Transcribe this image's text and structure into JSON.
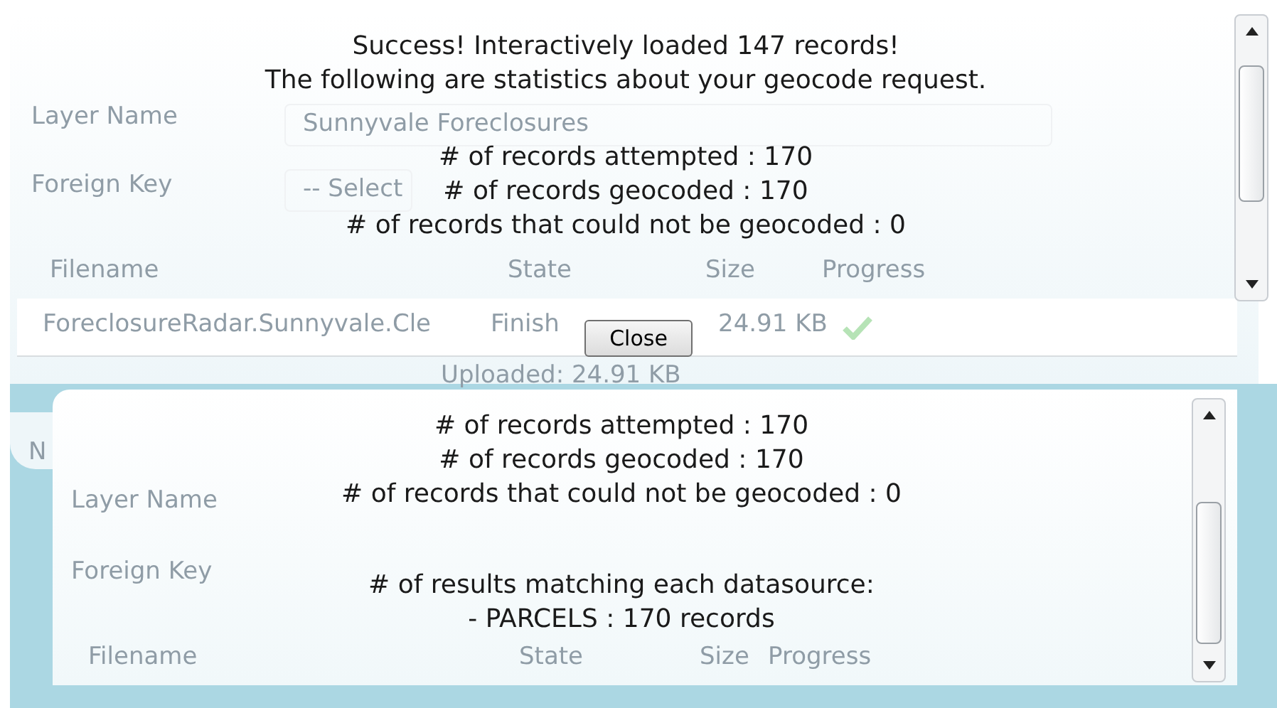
{
  "background_form": {
    "layer_name_label": "Layer Name",
    "layer_name_value": "Sunnyvale Foreclosures",
    "foreign_key_label": "Foreign Key",
    "foreign_key_value": "-- Select",
    "columns": [
      "Filename",
      "State",
      "Size",
      "Progress"
    ],
    "file_row": {
      "filename": "ForeclosureRadar.Sunnyvale.Cle",
      "state": "Finish",
      "size": "24.91 KB",
      "done": true
    },
    "uploaded": "Uploaded: 24.91 KB",
    "tab_label": "N"
  },
  "top_dialog": {
    "paragraphs": [
      [
        "Success! Interactively loaded 147 records!",
        "The following are statistics about your geocode request."
      ],
      [
        "# of records attempted : 170",
        "# of records geocoded : 170",
        "# of records that could not be geocoded : 0"
      ]
    ],
    "button": "Close"
  },
  "lower_dialog": {
    "form": {
      "layer_name_label": "Layer Name",
      "foreign_key_label": "Foreign Key",
      "columns": [
        "Filename",
        "State",
        "Size",
        "Progress"
      ]
    },
    "paragraphs": [
      [
        "# of records attempted : 170",
        "# of records geocoded : 170",
        "# of records that could not be geocoded : 0"
      ],
      [
        "# of results matching each datasource:",
        "- PARCELS : 170 records"
      ]
    ]
  }
}
